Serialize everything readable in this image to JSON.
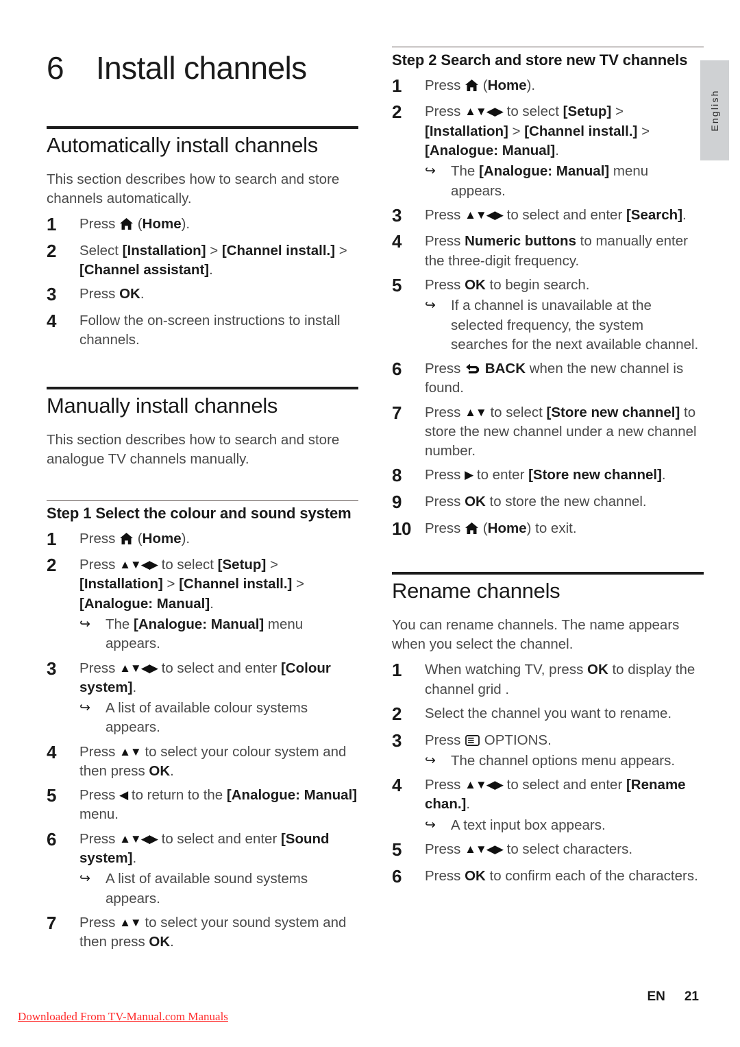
{
  "language_tab": {
    "label": "English"
  },
  "chapter": {
    "number": "6",
    "title": "Install channels"
  },
  "left_column": {
    "section1": {
      "title": "Automatically install channels",
      "intro": "This section describes how to search and store channels automatically.",
      "steps": [
        {
          "num": "1",
          "pre": "Press ",
          "icon": "home-icon",
          "post": " (",
          "bold": "Home",
          "tail": ")."
        },
        {
          "num": "2",
          "text_parts": [
            "Select ",
            "[Installation]",
            " > ",
            "[Channel install.]",
            " > ",
            "[Channel assistant]",
            "."
          ]
        },
        {
          "num": "3",
          "pre": "Press ",
          "bold": "OK",
          "tail": "."
        },
        {
          "num": "4",
          "plain": "Follow the on-screen instructions to install channels."
        }
      ]
    },
    "section2": {
      "title": "Manually install channels",
      "intro": "This section describes how to search and store analogue TV channels manually.",
      "step_heading": "Step 1 Select the colour and sound system",
      "steps": [
        {
          "num": "1",
          "pre": "Press ",
          "icon": "home-icon",
          "post": " (",
          "bold": "Home",
          "tail": ")."
        },
        {
          "num": "2",
          "pre": "Press ",
          "navpad": "▲▼◀▶",
          "post": " to select ",
          "bold1": "[Setup]",
          "mid1": " > ",
          "bold2": "[Installation]",
          "mid2": " > ",
          "bold3": "[Channel install.]",
          "mid3": " > ",
          "bold4": "[Analogue: Manual]",
          "tail": ".",
          "sub": {
            "pre": "The ",
            "bold": "[Analogue: Manual]",
            "post": " menu appears."
          }
        },
        {
          "num": "3",
          "pre": "Press ",
          "navpad": "▲▼◀▶",
          "post": " to select and enter ",
          "bold": "[Colour system]",
          "tail": ".",
          "sub": {
            "plain": "A list of available colour systems appears."
          }
        },
        {
          "num": "4",
          "pre": "Press ",
          "navpad": "▲▼",
          "post": " to select your colour system and then press ",
          "bold": "OK",
          "tail": "."
        },
        {
          "num": "5",
          "pre": "Press ",
          "navpad": "◀",
          "post": " to return to the ",
          "bold": "[Analogue: Manual]",
          "tail": " menu."
        },
        {
          "num": "6",
          "pre": "Press ",
          "navpad": "▲▼◀▶",
          "post": " to select and enter ",
          "bold": "[Sound system]",
          "tail": ".",
          "sub": {
            "plain": "A list of available sound systems appears."
          }
        },
        {
          "num": "7",
          "pre": "Press ",
          "navpad": "▲▼",
          "post": " to select your sound system and then press ",
          "bold": "OK",
          "tail": "."
        }
      ]
    }
  },
  "right_column": {
    "section1": {
      "step_heading": "Step 2 Search and store new TV channels",
      "steps": [
        {
          "num": "1",
          "pre": "Press ",
          "icon": "home-icon",
          "post": " (",
          "bold": "Home",
          "tail": ")."
        },
        {
          "num": "2",
          "pre": "Press ",
          "navpad": "▲▼◀▶",
          "post": " to select ",
          "bold1": "[Setup]",
          "mid1": " > ",
          "bold2": "[Installation]",
          "mid2": " > ",
          "bold3": "[Channel install.]",
          "mid3": " > ",
          "bold4": "[Analogue: Manual]",
          "tail": ".",
          "sub": {
            "pre": "The ",
            "bold": "[Analogue: Manual]",
            "post": " menu appears."
          }
        },
        {
          "num": "3",
          "pre": "Press ",
          "navpad": "▲▼◀▶",
          "post": " to select and enter ",
          "bold": "[Search]",
          "tail": "."
        },
        {
          "num": "4",
          "pre": "Press ",
          "bold": "Numeric buttons",
          "post": " to manually enter the three-digit frequency."
        },
        {
          "num": "5",
          "pre": "Press ",
          "bold": "OK",
          "post": " to begin search.",
          "sub": {
            "plain": "If a channel is unavailable at the selected frequency, the system searches for the next available channel."
          }
        },
        {
          "num": "6",
          "pre": "Press ",
          "icon": "back-icon",
          "bold": " BACK",
          "post": " when the new channel is found."
        },
        {
          "num": "7",
          "pre": "Press ",
          "navpad": "▲▼",
          "post": " to select ",
          "bold": "[Store new channel]",
          "tail": " to store the new channel under a new channel number."
        },
        {
          "num": "8",
          "pre": "Press ",
          "navpad": "▶",
          "post": " to enter ",
          "bold": "[Store new channel]",
          "tail": "."
        },
        {
          "num": "9",
          "pre": "Press ",
          "bold": "OK",
          "post": " to store the new channel."
        },
        {
          "num": "10",
          "pre": "Press ",
          "icon": "home-icon",
          "post": " (",
          "bold": "Home",
          "tail": ") to exit."
        }
      ]
    },
    "section2": {
      "title": "Rename channels",
      "intro": "You can rename channels. The name appears when you select the channel.",
      "steps": [
        {
          "num": "1",
          "pre": "When watching TV, press ",
          "bold": "OK",
          "post": " to display the channel grid ."
        },
        {
          "num": "2",
          "plain": "Select the channel you want to rename."
        },
        {
          "num": "3",
          "pre": "Press ",
          "icon": "options-icon",
          "post": " OPTIONS.",
          "sub": {
            "plain": "The channel options menu appears."
          }
        },
        {
          "num": "4",
          "pre": "Press ",
          "navpad": "▲▼◀▶",
          "post": " to select and enter ",
          "bold": "[Rename chan.]",
          "tail": ".",
          "sub": {
            "plain": "A text input box appears."
          }
        },
        {
          "num": "5",
          "pre": "Press ",
          "navpad": "▲▼◀▶",
          "post": " to select characters."
        },
        {
          "num": "6",
          "pre": "Press ",
          "bold": "OK",
          "post": " to confirm each of the characters."
        }
      ]
    }
  },
  "footer": {
    "language_code": "EN",
    "page_number": "21",
    "watermark": "Downloaded From TV-Manual.com Manuals"
  },
  "colors": {
    "heading": "#1a1a1a",
    "body": "#4a4a4a",
    "rule_thick": "#1c1c1c",
    "rule_thin": "#5a4e4c",
    "tab_bg": "#cfd1d3",
    "watermark": "#ff2a2a"
  }
}
